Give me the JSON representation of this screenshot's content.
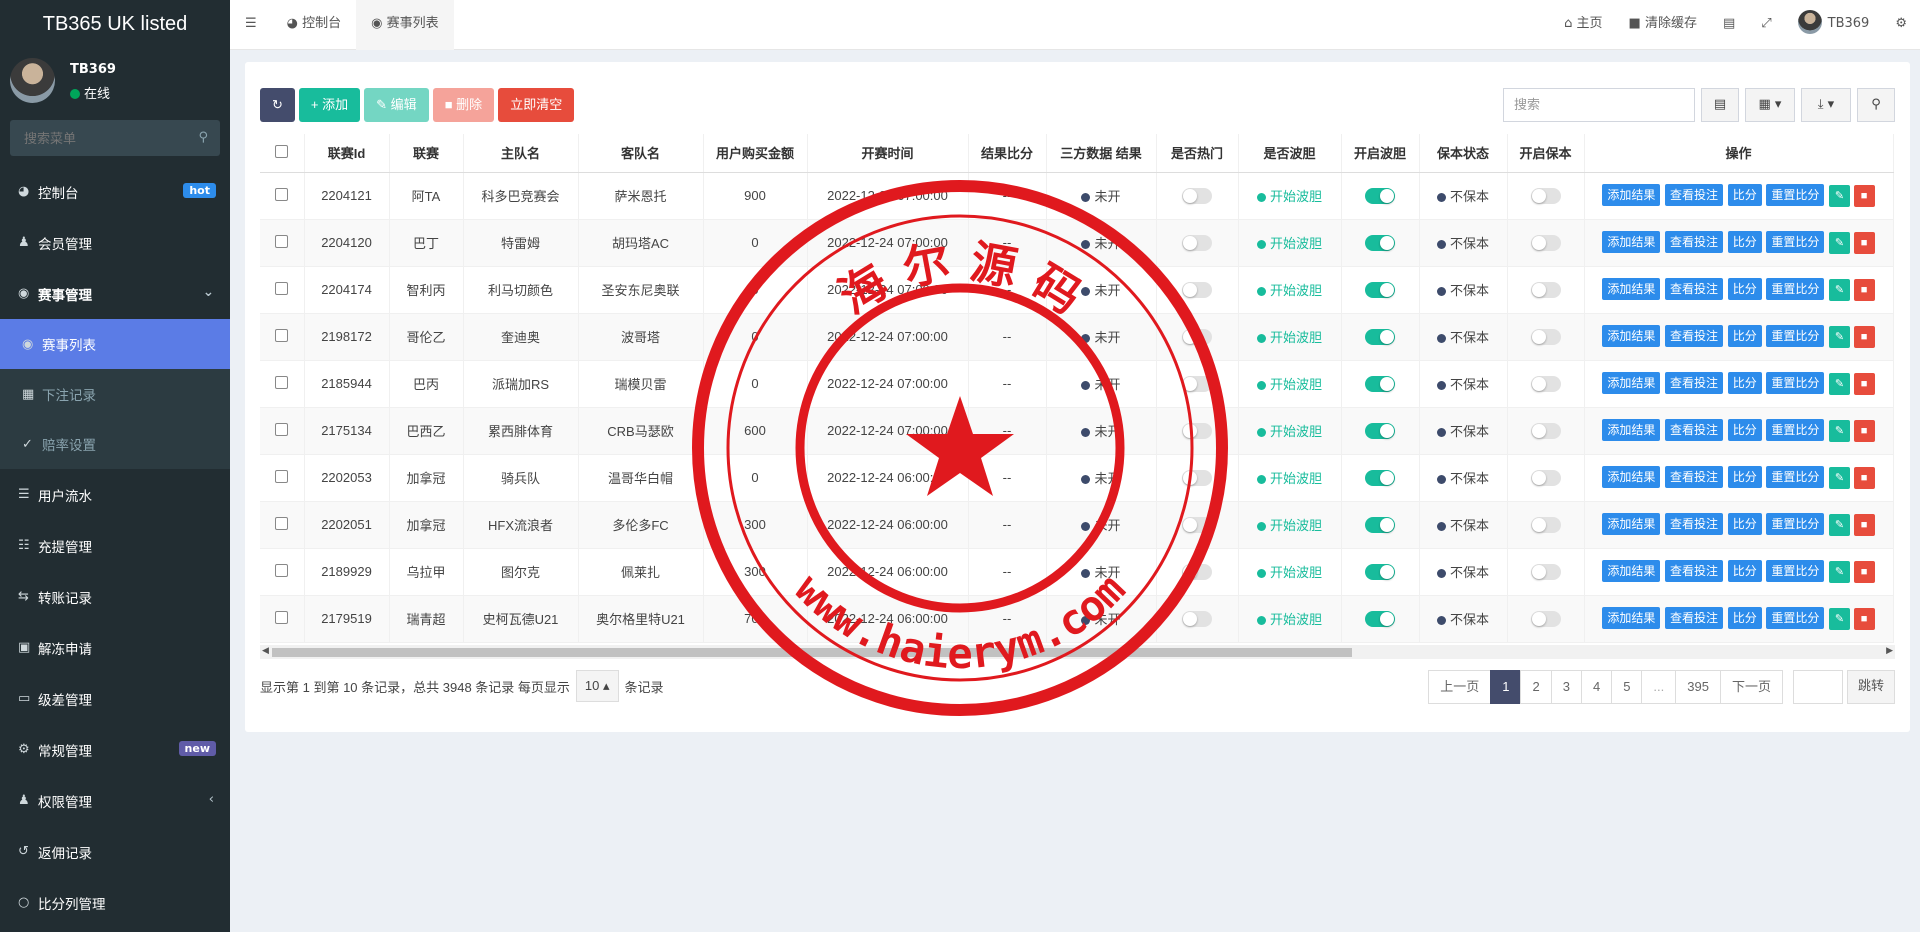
{
  "app": {
    "title": "TB365 UK listed"
  },
  "user": {
    "name": "TB369",
    "status": "在线"
  },
  "sidebar": {
    "search_placeholder": "搜索菜单",
    "items": [
      {
        "label": "控制台",
        "badge": "hot"
      },
      {
        "label": "会员管理"
      },
      {
        "label": "赛事管理"
      },
      {
        "label": "赛事列表"
      },
      {
        "label": "下注记录"
      },
      {
        "label": "赔率设置"
      },
      {
        "label": "用户流水"
      },
      {
        "label": "充提管理"
      },
      {
        "label": "转账记录"
      },
      {
        "label": "解冻申请"
      },
      {
        "label": "级差管理"
      },
      {
        "label": "常规管理",
        "badge": "new"
      },
      {
        "label": "权限管理"
      },
      {
        "label": "返佣记录"
      },
      {
        "label": "比分列管理"
      }
    ]
  },
  "topbar": {
    "tabs": [
      "控制台",
      "赛事列表"
    ],
    "home": "主页",
    "clear_cache": "清除缓存",
    "user": "TB369"
  },
  "toolbar": {
    "add": "添加",
    "edit": "编辑",
    "delete": "删除",
    "clear_now": "立即清空",
    "search_placeholder": "搜索"
  },
  "table": {
    "headers": [
      "联赛Id",
      "联赛",
      "主队名",
      "客队名",
      "用户购买金额",
      "开赛时间",
      "结果比分",
      "三方数据 结果",
      "是否热门",
      "是否波胆",
      "开启波胆",
      "保本状态",
      "开启保本",
      "操作"
    ],
    "rows": [
      [
        "2204121",
        "阿TA",
        "科多巴竞赛会",
        "萨米恩托",
        "900",
        "2022-12-24 07:00:00",
        "--",
        "未开",
        "开始波胆",
        "不保本"
      ],
      [
        "2204120",
        "巴丁",
        "特雷姆",
        "胡玛塔AC",
        "0",
        "2022-12-24 07:00:00",
        "--",
        "未开",
        "开始波胆",
        "不保本"
      ],
      [
        "2204174",
        "智利丙",
        "利马切颜色",
        "圣安东尼奥联",
        "0",
        "2022-12-24 07:00:00",
        "--",
        "未开",
        "开始波胆",
        "不保本"
      ],
      [
        "2198172",
        "哥伦乙",
        "奎迪奥",
        "波哥塔",
        "0",
        "2022-12-24 07:00:00",
        "--",
        "未开",
        "开始波胆",
        "不保本"
      ],
      [
        "2185944",
        "巴丙",
        "派瑞加RS",
        "瑞模贝雷",
        "0",
        "2022-12-24 07:00:00",
        "--",
        "未开",
        "开始波胆",
        "不保本"
      ],
      [
        "2175134",
        "巴西乙",
        "累西腓体育",
        "CRB马瑟欧",
        "600",
        "2022-12-24 07:00:00",
        "--",
        "未开",
        "开始波胆",
        "不保本"
      ],
      [
        "2202053",
        "加拿冠",
        "骑兵队",
        "温哥华白帽",
        "0",
        "2022-12-24 06:00:00",
        "--",
        "未开",
        "开始波胆",
        "不保本"
      ],
      [
        "2202051",
        "加拿冠",
        "HFX流浪者",
        "多伦多FC",
        "300",
        "2022-12-24 06:00:00",
        "--",
        "未开",
        "开始波胆",
        "不保本"
      ],
      [
        "2189929",
        "乌拉甲",
        "图尔克",
        "佩莱扎",
        "300",
        "2022-12-24 06:00:00",
        "--",
        "未开",
        "开始波胆",
        "不保本"
      ],
      [
        "2179519",
        "瑞青超",
        "史柯瓦德U21",
        "奥尔格里特U21",
        "700",
        "2022-12-24 06:00:00",
        "--",
        "未开",
        "开始波胆",
        "不保本"
      ]
    ],
    "row_toggles": [
      {
        "hot": false,
        "bodan": true,
        "baoben": false
      },
      {
        "hot": false,
        "bodan": true,
        "baoben": false
      },
      {
        "hot": false,
        "bodan": true,
        "baoben": false
      },
      {
        "hot": false,
        "bodan": true,
        "baoben": false
      },
      {
        "hot": false,
        "bodan": true,
        "baoben": false
      },
      {
        "hot": false,
        "bodan": true,
        "baoben": false
      },
      {
        "hot": false,
        "bodan": true,
        "baoben": false
      },
      {
        "hot": false,
        "bodan": true,
        "baoben": false
      },
      {
        "hot": false,
        "bodan": true,
        "baoben": false
      },
      {
        "hot": false,
        "bodan": true,
        "baoben": false
      }
    ],
    "actions": [
      "添加结果",
      "查看投注",
      "比分",
      "重置比分"
    ]
  },
  "footer": {
    "summary_prefix": "显示第 1 到第 10 条记录，总共 3948 条记录 每页显示",
    "page_size": "10",
    "summary_suffix": "条记录"
  },
  "pagination": {
    "prev": "上一页",
    "pages": [
      "1",
      "2",
      "3",
      "4",
      "5",
      "...",
      "395"
    ],
    "next": "下一页",
    "go": "跳转"
  },
  "watermark": {
    "top_text": "海 尔 源 码",
    "bottom_text": "www.haierym.com",
    "color": "#e0191e"
  },
  "colors": {
    "sidebar_bg": "#222d32",
    "active_menu": "#5b7ce6",
    "primary": "#2d8ceb",
    "green": "#18bc9c",
    "red": "#e74c3c",
    "dark_btn": "#444c6c"
  }
}
